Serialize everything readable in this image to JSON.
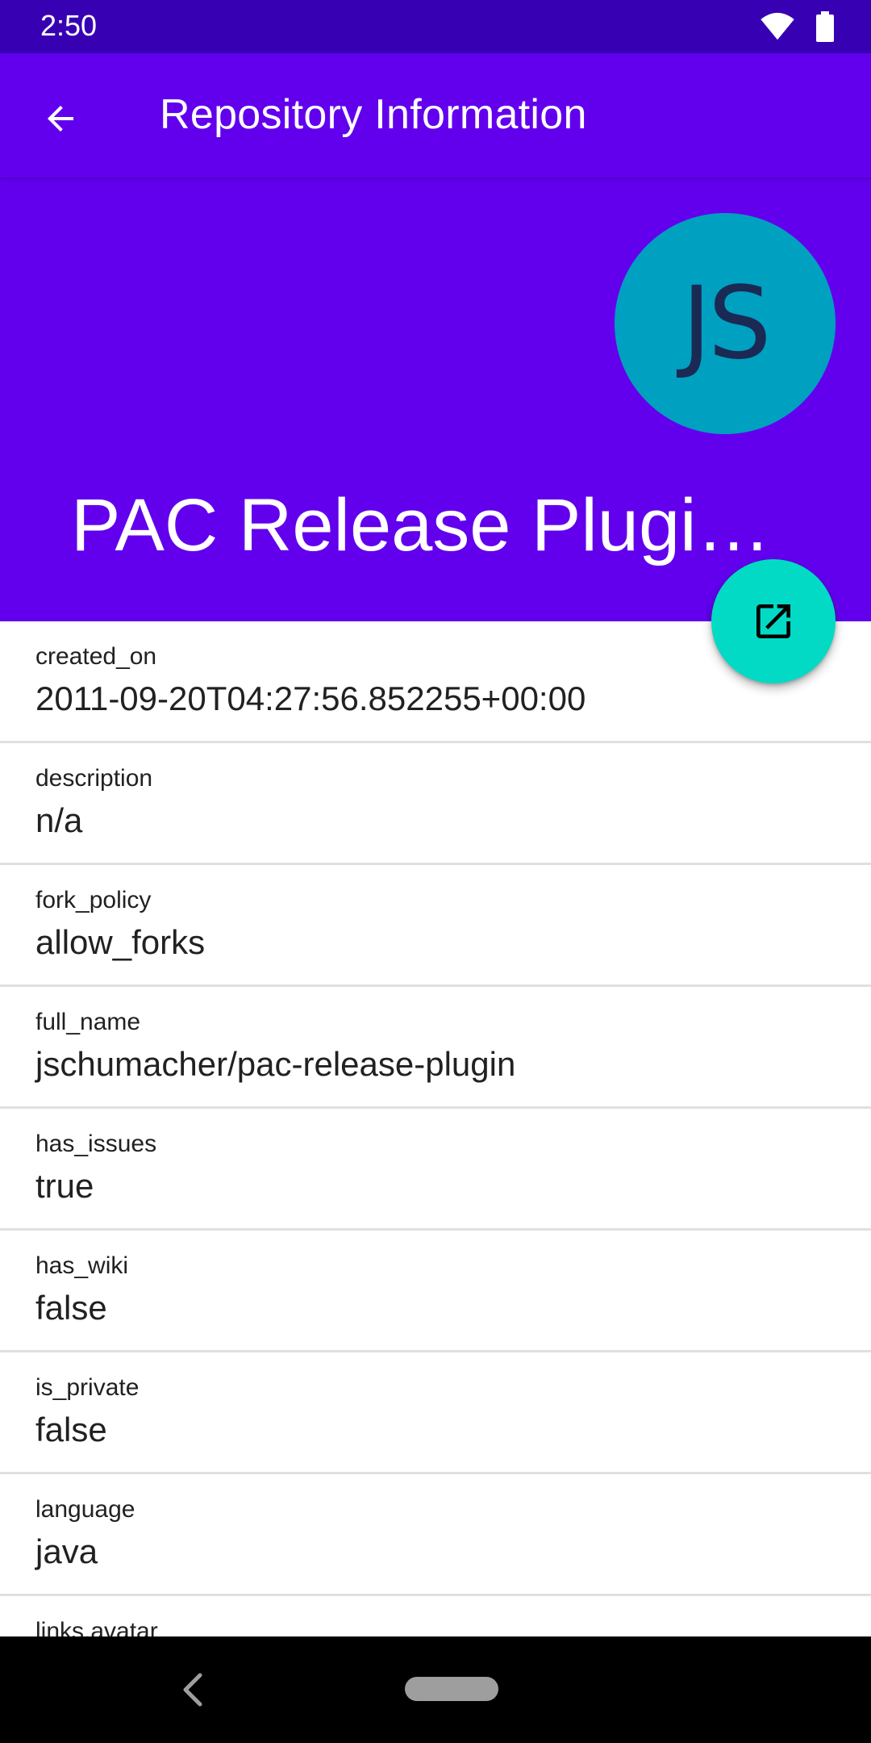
{
  "status_bar": {
    "time": "2:50",
    "icons": [
      "wifi-icon",
      "battery-icon"
    ]
  },
  "app_bar": {
    "title": "Repository Information",
    "back_icon": "arrow-back-icon"
  },
  "header": {
    "avatar_text": "JS",
    "repo_name": "PAC Release Plugin…"
  },
  "fab": {
    "icon": "open-in-new-icon"
  },
  "details": [
    {
      "label": "created_on",
      "value": "2011-09-20T04:27:56.852255+00:00"
    },
    {
      "label": "description",
      "value": "n/a"
    },
    {
      "label": "fork_policy",
      "value": "allow_forks"
    },
    {
      "label": "full_name",
      "value": "jschumacher/pac-release-plugin"
    },
    {
      "label": "has_issues",
      "value": "true"
    },
    {
      "label": "has_wiki",
      "value": "false"
    },
    {
      "label": "is_private",
      "value": "false"
    },
    {
      "label": "language",
      "value": "java"
    },
    {
      "label": "links.avatar",
      "value": ""
    }
  ],
  "colors": {
    "primary": "#6200ee",
    "primary_dark": "#3700b3",
    "accent": "#03dac5",
    "avatar_bg": "#00a0c0"
  }
}
